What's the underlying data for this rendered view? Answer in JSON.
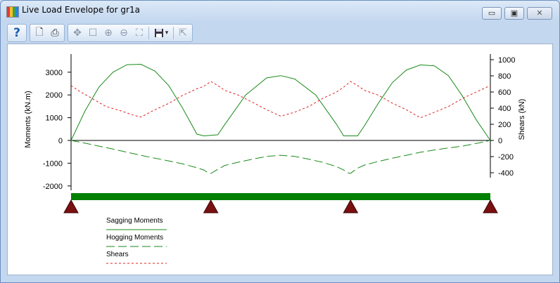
{
  "window": {
    "title": "Live Load Envelope for gr1a",
    "controls": {
      "minimize": "▭",
      "maximize": "▣",
      "close": "✕"
    }
  },
  "toolbar": {
    "buttons": [
      {
        "icon": "help-icon",
        "glyph": "?"
      },
      {
        "icon": "print-preview-icon",
        "glyph": "🗋"
      },
      {
        "icon": "print-icon",
        "glyph": "⎙"
      },
      {
        "icon": "pan-icon",
        "glyph": "✥"
      },
      {
        "icon": "select-rectangle-icon",
        "glyph": "☐"
      },
      {
        "icon": "zoom-in-icon",
        "glyph": "⊕"
      },
      {
        "icon": "zoom-out-icon",
        "glyph": "⊖"
      },
      {
        "icon": "zoom-extents-icon",
        "glyph": "⛶"
      },
      {
        "icon": "save-icon",
        "glyph": "▾"
      },
      {
        "icon": "export-icon",
        "glyph": "⇱"
      }
    ]
  },
  "colors": {
    "sagging": "#1a8a1a",
    "hogging": "#1a8a1a",
    "shears": "#e02020",
    "beam": "#008000",
    "support": "#7a1010"
  },
  "chart_data": {
    "type": "line",
    "ylabel": "Moments (kN.m)",
    "y2label": "Shears (kN)",
    "ylim": [
      -2000,
      3000
    ],
    "y_ticks": [
      "3000",
      "2000",
      "1000",
      "0",
      "-1000",
      "-2000"
    ],
    "y2lim": [
      -400,
      1000
    ],
    "y2_ticks": [
      "1000",
      "800",
      "600",
      "400",
      "200",
      "0",
      "-200",
      "-400"
    ],
    "xlim": [
      0,
      3
    ],
    "supports_x": [
      0,
      1,
      2,
      3
    ],
    "legend": {
      "placement": "bottom-left",
      "entries": [
        "Sagging Moments",
        "Hogging Moments",
        "Shears"
      ]
    },
    "series": [
      {
        "name": "Sagging Moments",
        "style": "solid",
        "axis": "left",
        "x": [
          0,
          0.1,
          0.2,
          0.3,
          0.4,
          0.5,
          0.6,
          0.7,
          0.8,
          0.9,
          0.95,
          1.05,
          1.1,
          1.25,
          1.4,
          1.5,
          1.6,
          1.75,
          1.9,
          1.95,
          2.05,
          2.1,
          2.2,
          2.3,
          2.4,
          2.5,
          2.6,
          2.7,
          2.8,
          2.9,
          3.0
        ],
        "y": [
          0,
          1300,
          2350,
          3000,
          3330,
          3350,
          3050,
          2400,
          1400,
          280,
          200,
          250,
          700,
          2000,
          2750,
          2850,
          2700,
          2000,
          700,
          200,
          200,
          650,
          1650,
          2550,
          3100,
          3320,
          3280,
          2850,
          1950,
          900,
          0
        ]
      },
      {
        "name": "Hogging Moments",
        "style": "dashed",
        "axis": "left",
        "x": [
          0,
          0.1,
          0.2,
          0.3,
          0.4,
          0.5,
          0.6,
          0.7,
          0.8,
          0.9,
          0.95,
          0.98,
          1.0,
          1.02,
          1.05,
          1.1,
          1.2,
          1.3,
          1.4,
          1.5,
          1.6,
          1.7,
          1.8,
          1.9,
          1.95,
          1.98,
          2.0,
          2.02,
          2.05,
          2.1,
          2.2,
          2.3,
          2.4,
          2.5,
          2.6,
          2.7,
          2.8,
          2.9,
          3.0
        ],
        "y": [
          0,
          -120,
          -250,
          -380,
          -520,
          -650,
          -780,
          -900,
          -1030,
          -1200,
          -1300,
          -1420,
          -1450,
          -1380,
          -1270,
          -1100,
          -950,
          -820,
          -700,
          -650,
          -700,
          -820,
          -960,
          -1150,
          -1300,
          -1420,
          -1450,
          -1350,
          -1220,
          -1080,
          -920,
          -780,
          -650,
          -520,
          -420,
          -330,
          -250,
          -130,
          0
        ]
      },
      {
        "name": "Shears",
        "style": "dotted",
        "axis": "right",
        "x": [
          0,
          0.05,
          0.15,
          0.25,
          0.35,
          0.45,
          0.5,
          0.6,
          0.7,
          0.8,
          0.9,
          0.95,
          1.0,
          1.05,
          1.1,
          1.2,
          1.3,
          1.4,
          1.5,
          1.6,
          1.7,
          1.8,
          1.9,
          1.95,
          2.0,
          2.05,
          2.1,
          2.2,
          2.3,
          2.4,
          2.5,
          2.6,
          2.7,
          2.8,
          2.9,
          3.0
        ],
        "y": [
          680,
          620,
          520,
          420,
          370,
          310,
          290,
          380,
          460,
          560,
          640,
          670,
          730,
          680,
          620,
          560,
          470,
          380,
          300,
          350,
          420,
          520,
          600,
          660,
          730,
          680,
          620,
          560,
          460,
          380,
          280,
          350,
          420,
          520,
          600,
          680
        ]
      }
    ]
  }
}
